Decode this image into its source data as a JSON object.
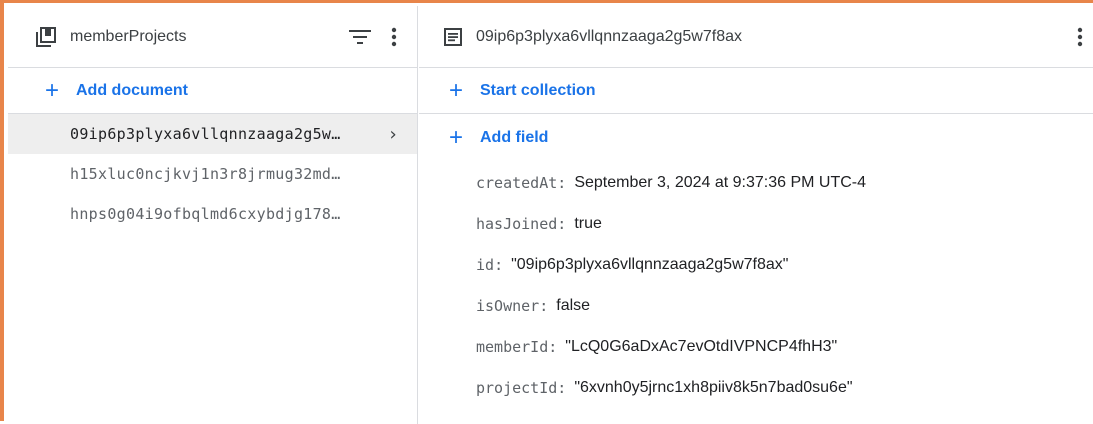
{
  "collection": {
    "title": "memberProjects",
    "add_document_label": "Add document",
    "icons": {
      "collection": "collection-icon",
      "filter": "filter-icon",
      "more": "more-vert-icon"
    },
    "documents": [
      {
        "id": "09ip6p3plyxa6vllqnnzaaga2g5w…",
        "selected": true
      },
      {
        "id": "h15xluc0ncjkvj1n3r8jrmug32md…",
        "selected": false
      },
      {
        "id": "hnps0g04i9ofbqlmd6cxybdjg178…",
        "selected": false
      }
    ]
  },
  "document": {
    "title": "09ip6p3plyxa6vllqnnzaaga2g5w7f8ax",
    "start_collection_label": "Start collection",
    "add_field_label": "Add field",
    "icons": {
      "document": "document-icon",
      "more": "more-vert-icon"
    },
    "fields": [
      {
        "key": "createdAt",
        "value": "September 3, 2024 at 9:37:36 PM UTC-4"
      },
      {
        "key": "hasJoined",
        "value": "true"
      },
      {
        "key": "id",
        "value": "\"09ip6p3plyxa6vllqnnzaaga2g5w7f8ax\""
      },
      {
        "key": "isOwner",
        "value": "false"
      },
      {
        "key": "memberId",
        "value": "\"LcQ0G6aDxAc7evOtdIVPNCP4fhH3\""
      },
      {
        "key": "projectId",
        "value": "\"6xvnh0y5jrnc1xh8piiv8k5n7bad0su6e\""
      }
    ]
  },
  "colors": {
    "accent": "#1a73e8",
    "frame": "#e8854a",
    "selected_bg": "#eeeeee"
  }
}
